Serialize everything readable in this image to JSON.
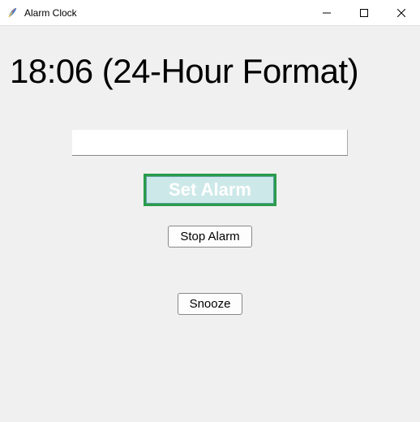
{
  "window": {
    "title": "Alarm Clock"
  },
  "main": {
    "time_display": "18:06 (24-Hour Format)",
    "alarm_input_value": "",
    "alarm_input_placeholder": "",
    "set_alarm_label": "Set Alarm",
    "stop_alarm_label": "Stop Alarm",
    "snooze_label": "Snooze"
  },
  "colors": {
    "set_alarm_border": "#2a9c4a",
    "set_alarm_bg": "#cde8e8",
    "set_alarm_text": "#ffffff"
  }
}
